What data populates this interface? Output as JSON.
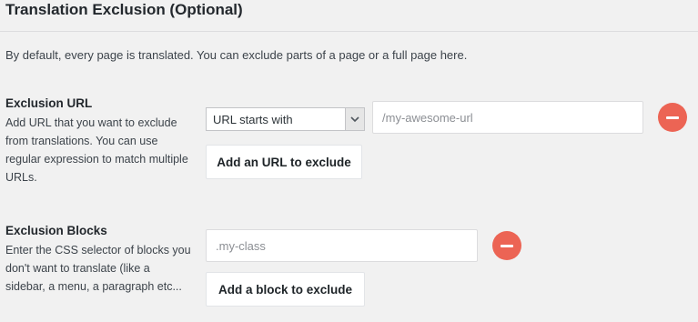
{
  "section": {
    "title": "Translation Exclusion (Optional)",
    "intro": "By default, every page is translated. You can exclude parts of a page or a full page here."
  },
  "exclusion_url": {
    "label": "Exclusion URL",
    "description": "Add URL that you want to exclude from translations. You can use regular expression to match multiple URLs.",
    "rule_select": {
      "selected": "URL starts with"
    },
    "url_input": {
      "placeholder": "/my-awesome-url"
    },
    "add_button": "Add an URL to exclude"
  },
  "exclusion_blocks": {
    "label": "Exclusion Blocks",
    "description": "Enter the CSS selector of blocks you don't want to translate (like a sidebar, a menu, a paragraph etc...",
    "selector_input": {
      "placeholder": ".my-class"
    },
    "add_button": "Add a block to exclude"
  },
  "icons": {
    "remove": "minus-circle-icon",
    "dropdown": "chevron-down-icon"
  },
  "colors": {
    "remove_button": "#ec6454",
    "background": "#f1f1f1"
  }
}
